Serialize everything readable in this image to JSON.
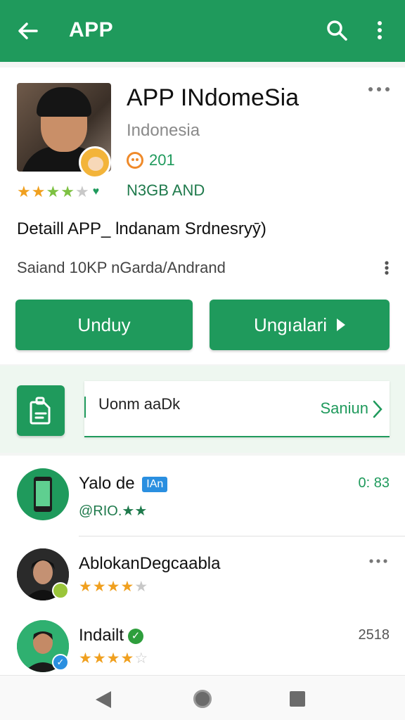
{
  "header": {
    "title": "APP"
  },
  "app": {
    "name": "APP INdomeSia",
    "region": "Indonesia",
    "count": "201",
    "rating_stars": 4,
    "meta": "N3GB AND",
    "detail": "Detaill APP_ lndanam Srdnesryȳ)",
    "subline": "Saiand  10KP nGarda/Andrand"
  },
  "buttons": {
    "primary": "Unduу",
    "secondary": "Ungıalari"
  },
  "input": {
    "value": "Uonm aaDk",
    "action": "Saniun"
  },
  "list": [
    {
      "name": "Yalo de",
      "tag": "IAn",
      "right": "0: 83",
      "sub": "@RIO.★★"
    },
    {
      "name": "AblokanDegcaabla",
      "right": "",
      "stars": 4
    },
    {
      "name": "Indailt",
      "right": "2518",
      "stars": 4
    }
  ],
  "colors": {
    "brand": "#1f9a5c",
    "star": "#f0a01f"
  }
}
